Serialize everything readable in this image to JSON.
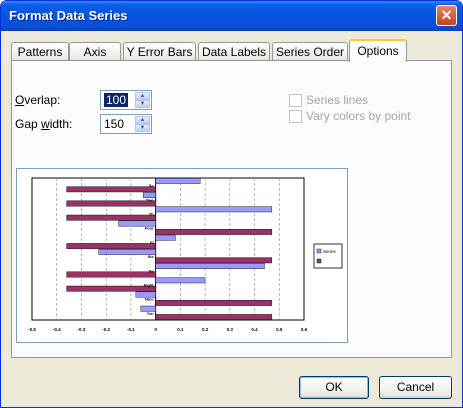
{
  "window": {
    "title": "Format Data Series"
  },
  "tabs": [
    {
      "label": "Patterns"
    },
    {
      "label": "Axis"
    },
    {
      "label": "Y Error Bars"
    },
    {
      "label": "Data Labels"
    },
    {
      "label": "Series Order"
    },
    {
      "label": "Options"
    }
  ],
  "options": {
    "overlap_label_u": "O",
    "overlap_label_rest": "verlap:",
    "overlap_value": "100",
    "gap_label_pre": "Gap ",
    "gap_label_u": "w",
    "gap_label_rest": "idth:",
    "gap_value": "150",
    "series_lines_label": "Series lines",
    "vary_colors_label": "Vary colors by point"
  },
  "buttons": {
    "ok": "OK",
    "cancel": "Cancel"
  },
  "colors": {
    "series1": "#9999ff",
    "series2": "#993366"
  },
  "chart_data": {
    "type": "bar",
    "orientation": "horizontal",
    "overlap": 100,
    "gap_width": 150,
    "x_ticks": [
      "-0.5",
      "-0.4",
      "-0.3",
      "-0.2",
      "-0.1",
      "0",
      "0.1",
      "0.2",
      "0.3",
      "0.4",
      "0.5",
      "0.6"
    ],
    "xlim": [
      -0.5,
      0.6
    ],
    "grid": true,
    "legend_position": "right",
    "legend": [
      "Series",
      ""
    ],
    "series": [
      {
        "values": [
          0.18,
          -0.05,
          0.47,
          -0.15,
          0.08,
          -0.23,
          0.44,
          0.2,
          -0.08,
          -0.06
        ]
      },
      {
        "values": [
          -0.36,
          -0.36,
          -0.36,
          0.47,
          -0.36,
          0.47,
          -0.36,
          -0.36,
          0.47,
          0.47
        ]
      }
    ],
    "category_labels": [
      "Sc",
      "Two",
      "Th",
      "Four",
      "Fi",
      "Six",
      "Se",
      "Eight",
      "Nine",
      "Ten"
    ]
  }
}
